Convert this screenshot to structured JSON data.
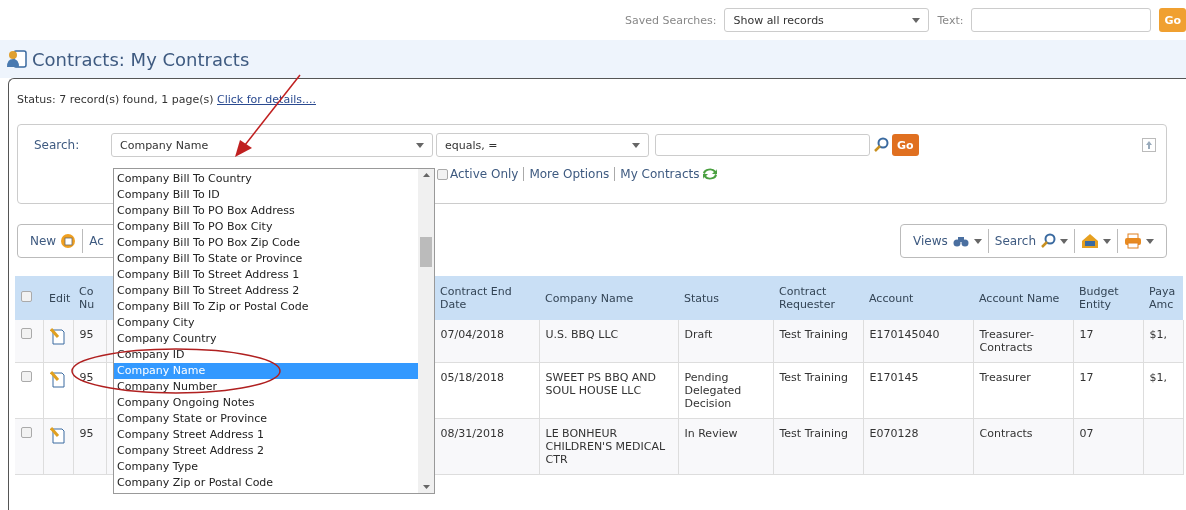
{
  "top_bar": {
    "saved_searches_label": "Saved Searches:",
    "saved_search": "Show all records",
    "text_label": "Text:",
    "go_label": "Go"
  },
  "page_title": "Contracts: My Contracts",
  "status": {
    "text": "Status: 7 record(s) found, 1 page(s)",
    "link": "Click for details...."
  },
  "search": {
    "label": "Search:",
    "field": "Company Name",
    "operator": "equals, =",
    "go_label": "Go",
    "filters": [
      {
        "kind": "checkbox",
        "label": "Active Only",
        "checked": false
      },
      {
        "kind": "link",
        "label": "More Options"
      },
      {
        "kind": "link",
        "label": "My Contracts"
      }
    ]
  },
  "field_dropdown": {
    "items": [
      {
        "label": "Company Bill To Country",
        "selected": false
      },
      {
        "label": "Company Bill To ID",
        "selected": false
      },
      {
        "label": "Company Bill To PO Box Address",
        "selected": false
      },
      {
        "label": "Company Bill To PO Box City",
        "selected": false
      },
      {
        "label": "Company Bill To PO Box Zip Code",
        "selected": false
      },
      {
        "label": "Company Bill To State or Province",
        "selected": false
      },
      {
        "label": "Company Bill To Street Address 1",
        "selected": false
      },
      {
        "label": "Company Bill To Street Address 2",
        "selected": false
      },
      {
        "label": "Company Bill To Zip or Postal Code",
        "selected": false
      },
      {
        "label": "Company City",
        "selected": false
      },
      {
        "label": "Company Country",
        "selected": false
      },
      {
        "label": "Company ID",
        "selected": false
      },
      {
        "label": "Company Name",
        "selected": true
      },
      {
        "label": "Company Number",
        "selected": false
      },
      {
        "label": "Company Ongoing Notes",
        "selected": false
      },
      {
        "label": "Company State or Province",
        "selected": false
      },
      {
        "label": "Company Street Address 1",
        "selected": false
      },
      {
        "label": "Company Street Address 2",
        "selected": false
      },
      {
        "label": "Company Type",
        "selected": false
      },
      {
        "label": "Company Zip or Postal Code",
        "selected": false
      }
    ]
  },
  "toolbar": {
    "left": [
      "New",
      "Ac"
    ],
    "right": [
      "Views",
      "Search"
    ]
  },
  "table": {
    "header_checked": false,
    "columns": [
      "Edit",
      "Co Nu",
      "Contract End Date",
      "Company Name",
      "Status",
      "Contract Requester",
      "Account",
      "Account Name",
      "Budget Entity",
      "Paya Amc"
    ],
    "rows": [
      {
        "checked": false,
        "number": "95",
        "end_date": "07/04/2018",
        "company": "U.S. BBQ LLC",
        "status": "Draft",
        "requester": "Test Training",
        "account": "E170145040",
        "account_name": "Treasurer-Contracts",
        "budget_entity": "17",
        "payable": "$1,"
      },
      {
        "checked": false,
        "number": "95",
        "end_date": "05/18/2018",
        "company": "SWEET PS BBQ AND SOUL HOUSE LLC",
        "status": "Pending Delegated Decision",
        "requester": "Test Training",
        "account": "E170145",
        "account_name": "Treasurer",
        "budget_entity": "17",
        "payable": "$1,"
      },
      {
        "checked": false,
        "number": "95",
        "end_date": "08/31/2018",
        "company": "LE BONHEUR CHILDREN'S MEDICAL CTR",
        "status": "In Review",
        "requester": "Test Training",
        "account": "E070128",
        "account_name": "Contracts",
        "budget_entity": "07"
      }
    ]
  }
}
